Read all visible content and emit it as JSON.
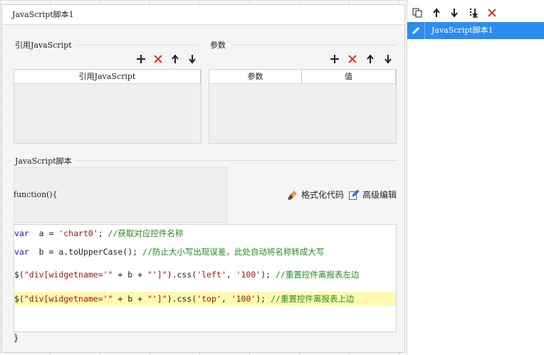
{
  "dialog": {
    "title": "JavaScript脚本1"
  },
  "ref_section": {
    "label": "引用JavaScript",
    "columns": [
      "引用JavaScript"
    ]
  },
  "param_section": {
    "label": "参数",
    "columns": [
      "参数",
      "值"
    ]
  },
  "script_section": {
    "label": "JavaScript脚本",
    "function_header": "function(){",
    "format_label": "格式化代码",
    "advanced_label": "高级编辑",
    "closing_brace": "}"
  },
  "code_lines": [
    {
      "parts": [
        [
          "kw",
          "var"
        ],
        [
          "",
          "  a = "
        ],
        [
          "str",
          "'chart0'"
        ],
        [
          "",
          "; "
        ],
        [
          "cmt",
          "//获取对应控件名称"
        ]
      ]
    },
    {
      "parts": [
        [
          "kw",
          "var"
        ],
        [
          "",
          "  b = a.toUpperCase(); "
        ],
        [
          "cmt",
          "//防止大小写出现误差，此处自动将名称转成大写"
        ]
      ]
    },
    {
      "parts": [
        [
          "",
          "$("
        ],
        [
          "str",
          "\"div[widgetname='\""
        ],
        [
          "",
          " + b + "
        ],
        [
          "str",
          "\"']\""
        ],
        [
          "",
          ").css("
        ],
        [
          "str",
          "'left'"
        ],
        [
          "",
          ", "
        ],
        [
          "str",
          "'100'"
        ],
        [
          "",
          "); "
        ],
        [
          "cmt",
          "//重置控件离报表左边"
        ]
      ]
    },
    {
      "parts": [
        [
          "",
          "$("
        ],
        [
          "str",
          "\"div[widgetname='\""
        ],
        [
          "",
          " + b + "
        ],
        [
          "str",
          "\"']\""
        ],
        [
          "",
          ").css("
        ],
        [
          "str",
          "'top'"
        ],
        [
          "",
          ", "
        ],
        [
          "str",
          "'100'"
        ],
        [
          "",
          "); "
        ],
        [
          "cmt",
          "//重置控件离报表上边"
        ]
      ]
    }
  ],
  "right_panel": {
    "items": [
      {
        "label": "JavaScript脚本1",
        "selected": true
      }
    ]
  },
  "icons": {
    "add": "plus-icon",
    "delete": "x-icon",
    "up": "arrow-up-icon",
    "down": "arrow-down-icon",
    "copy": "copy-icon",
    "move_bottom": "move-to-bottom-icon",
    "pencil": "pencil-icon",
    "brush": "brush-icon",
    "edit": "edit-icon"
  },
  "colors": {
    "accent": "#2c8cf0",
    "delete": "#e23a2e",
    "highlight": "#fffab0"
  }
}
